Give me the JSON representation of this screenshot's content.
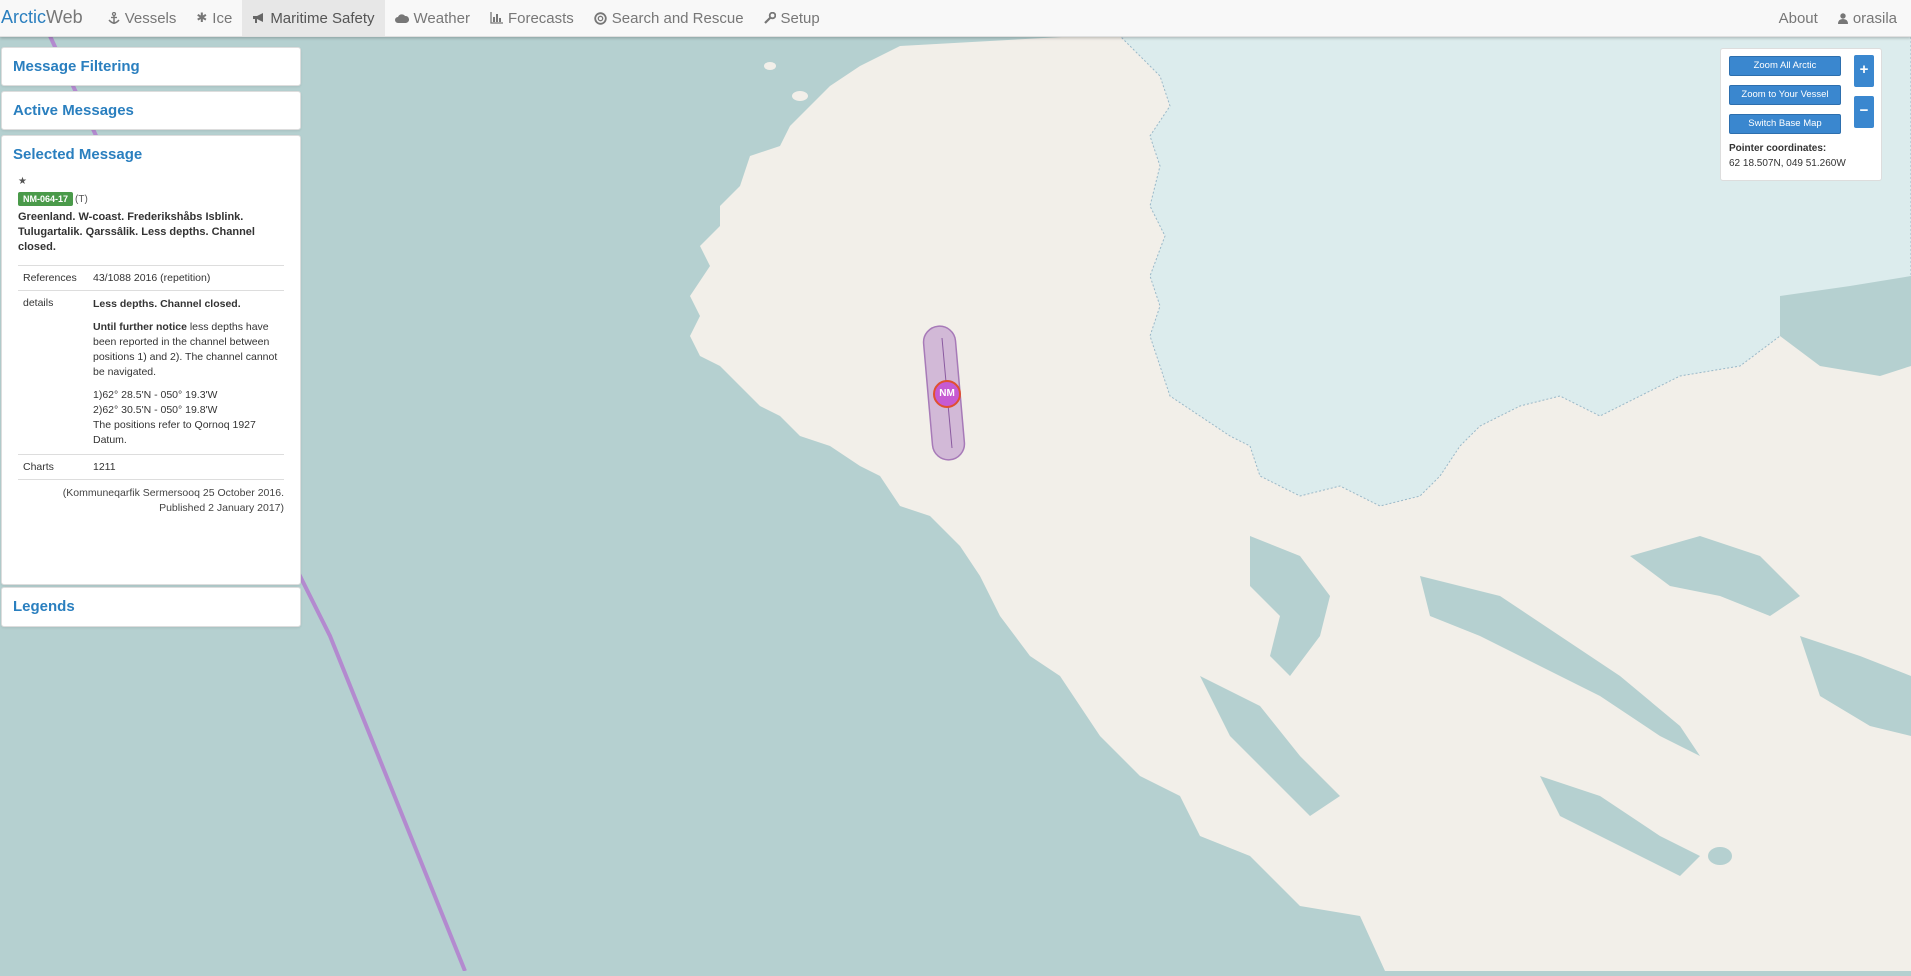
{
  "brand": {
    "part1": "Arctic",
    "part2": "Web"
  },
  "nav": [
    {
      "label": "Vessels",
      "icon": "anchor-icon"
    },
    {
      "label": "Ice",
      "icon": "asterisk-icon"
    },
    {
      "label": "Maritime Safety",
      "icon": "bullhorn-icon",
      "active": true
    },
    {
      "label": "Weather",
      "icon": "cloud-icon"
    },
    {
      "label": "Forecasts",
      "icon": "bar-chart-icon"
    },
    {
      "label": "Search and Rescue",
      "icon": "lifebuoy-icon"
    },
    {
      "label": "Setup",
      "icon": "wrench-icon"
    }
  ],
  "nav_right": {
    "about": "About",
    "user": "orasila"
  },
  "panels": {
    "filtering": "Message Filtering",
    "active": "Active Messages",
    "selected": "Selected Message",
    "legends": "Legends"
  },
  "message": {
    "star": "★",
    "id": "NM-064-17",
    "flag": "(T)",
    "title": "Greenland. W-coast. Frederikshåbs Isblink. Tulugartalik. Qarssâlik. Less depths. Channel closed.",
    "references_label": "References",
    "references": "43/1088 2016 (repetition)",
    "details_label": "details",
    "details_heading": "Less depths. Channel closed.",
    "details_bold": "Until further notice",
    "details_text": " less depths have been reported in the channel between positions 1) and 2). The channel cannot be navigated.",
    "pos1": "1)62° 28.5'N - 050° 19.3'W",
    "pos2": "2)62° 30.5'N - 050° 19.8'W",
    "datum": "The positions refer to Qornoq 1927 Datum.",
    "charts_label": "Charts",
    "charts": "1211",
    "source": "(Kommuneqarfik Sermersooq 25 October 2016.",
    "published": "Published 2 January 2017)"
  },
  "controls": {
    "zoom_all": "Zoom All Arctic",
    "zoom_vessel": "Zoom to Your Vessel",
    "switch_base": "Switch Base Map",
    "zoom_in": "+",
    "zoom_out": "−",
    "coord_label": "Pointer coordinates:",
    "coord_value": "62 18.507N, 049 51.260W"
  },
  "map": {
    "marker_label": "NM",
    "colors": {
      "sea": "#b5d0d0",
      "land": "#f2efe9",
      "ice": "#dceced",
      "route": "#b38acf",
      "marker": "#c65ad2"
    }
  }
}
